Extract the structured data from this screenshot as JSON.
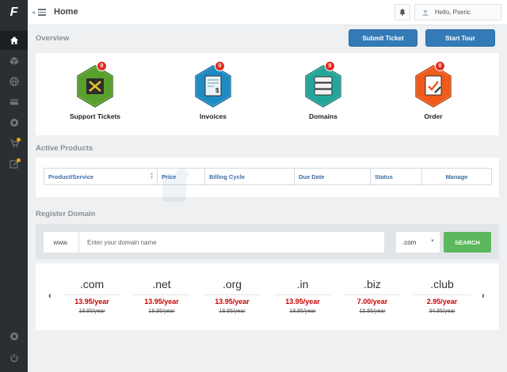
{
  "topbar": {
    "title": "Home",
    "user_label": "Hello, Pseric"
  },
  "sidebar": {
    "logo": "F",
    "items": [
      {
        "icon": "home-icon"
      },
      {
        "icon": "cube-icon"
      },
      {
        "icon": "globe-icon"
      },
      {
        "icon": "credit-card-icon"
      },
      {
        "icon": "lifebuoy-icon"
      },
      {
        "icon": "cart-icon"
      },
      {
        "icon": "edit-icon"
      },
      {
        "icon": "power-icon"
      }
    ]
  },
  "overview": {
    "heading": "Overview",
    "submit_ticket": "Submit Ticket",
    "start_tour": "Start Tour",
    "tiles": [
      {
        "label": "Support Tickets",
        "badge": "0",
        "color": "#5aa02c"
      },
      {
        "label": "Invoices",
        "badge": "0",
        "color": "#1e8bc3"
      },
      {
        "label": "Domains",
        "badge": "0",
        "color": "#26a69a"
      },
      {
        "label": "Order",
        "badge": "0",
        "color": "#f05a1a"
      }
    ]
  },
  "products": {
    "heading": "Active Products",
    "columns": [
      "Product/Service",
      "Price",
      "Billing Cycle",
      "Due Date",
      "Status",
      "Manage"
    ]
  },
  "register": {
    "heading": "Register Domain",
    "prefix": "www.",
    "placeholder": "Enter your domain name",
    "tld_selected": ".com",
    "search_label": "SEARCH"
  },
  "pricing": {
    "prev": "‹",
    "next": "›",
    "items": [
      {
        "tld": ".com",
        "price": "13.95/year",
        "old": "18.95/year"
      },
      {
        "tld": ".net",
        "price": "13.95/year",
        "old": "18.95/year"
      },
      {
        "tld": ".org",
        "price": "13.95/year",
        "old": "18.95/year"
      },
      {
        "tld": ".in",
        "price": "13.95/year",
        "old": "18.95/year"
      },
      {
        "tld": ".biz",
        "price": "7.00/year",
        "old": "15.95/year"
      },
      {
        "tld": ".club",
        "price": "2.95/year",
        "old": "34.95/year"
      }
    ]
  },
  "colors": {
    "accent_blue": "#337ab7",
    "search_green": "#5cb85c",
    "price_red": "#cc0000",
    "sidebar_bg": "#2b2f33"
  }
}
